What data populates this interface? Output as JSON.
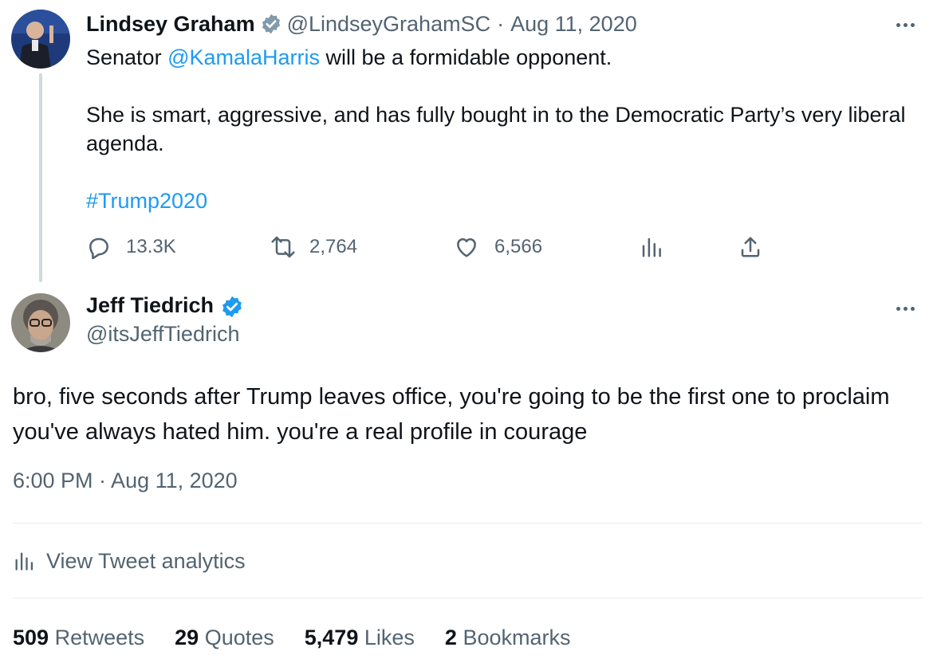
{
  "quoted": {
    "name": "Lindsey Graham",
    "handle": "@LindseyGrahamSC",
    "separator": "·",
    "date": "Aug 11, 2020",
    "text_before_mention": "Senator ",
    "mention": "@KamalaHarris",
    "text_after_mention": " will be a formidable opponent.",
    "paragraph2": "She is smart, aggressive, and has fully bought in to the Democratic Party’s very liberal agenda.",
    "hashtag": "#Trump2020",
    "verified_badge_color": "#829aab",
    "actions": {
      "replies": "13.3K",
      "retweets": "2,764",
      "likes": "6,566"
    }
  },
  "main": {
    "name": "Jeff Tiedrich",
    "handle": "@itsJeffTiedrich",
    "verified_badge_color": "#1d9bf0",
    "text": "bro, five seconds after Trump leaves office, you're going to be the first one to proclaim you've always hated him. you're a real profile in courage",
    "timestamp": "6:00 PM · Aug 11, 2020",
    "analytics_label": "View Tweet analytics",
    "stats": [
      {
        "value": "509",
        "label": "Retweets"
      },
      {
        "value": "29",
        "label": "Quotes"
      },
      {
        "value": "5,479",
        "label": "Likes"
      },
      {
        "value": "2",
        "label": "Bookmarks"
      }
    ]
  },
  "icons": {
    "reply": "reply-icon",
    "retweet": "retweet-icon",
    "like": "heart-icon",
    "views": "bar-chart-icon",
    "share": "share-icon",
    "more": "more-icon"
  },
  "colors": {
    "link": "#1d9bf0",
    "muted": "#536471",
    "text": "#0f1419"
  }
}
